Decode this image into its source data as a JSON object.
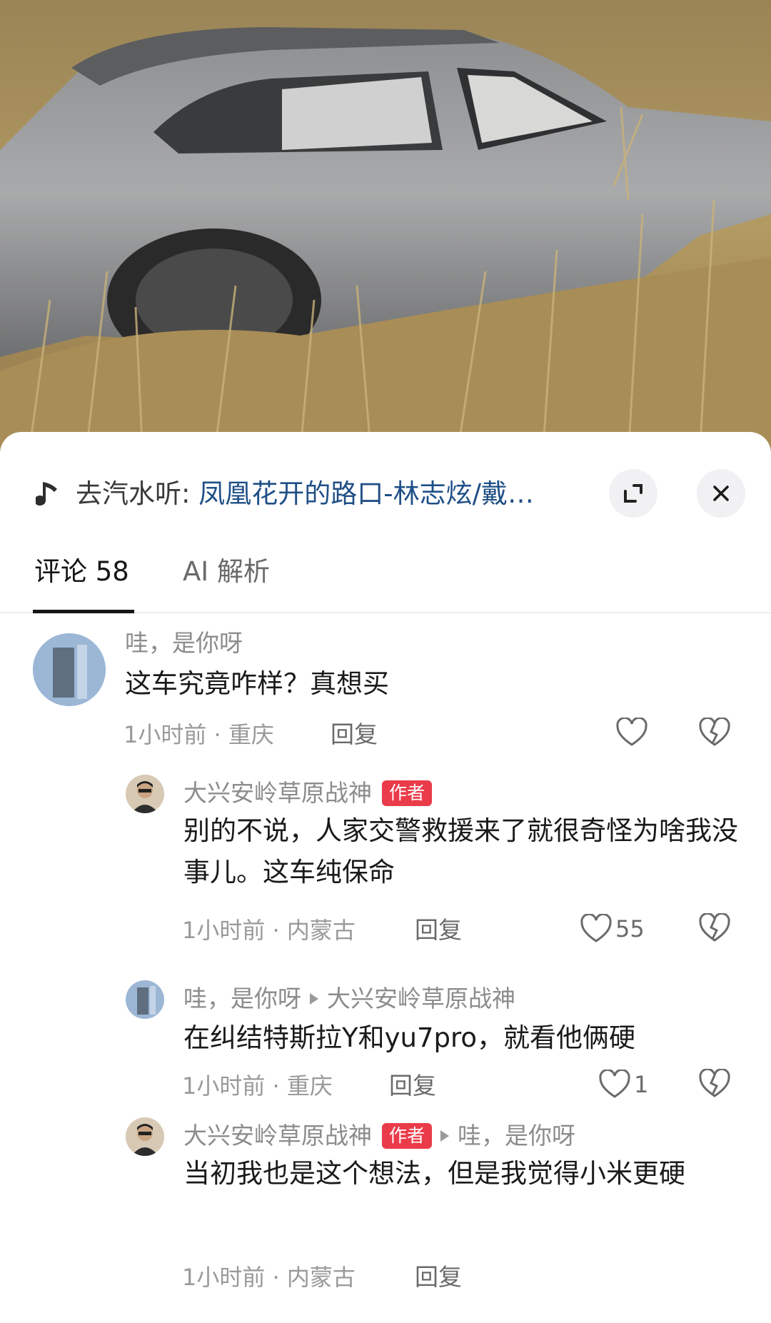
{
  "music": {
    "prefix": "去汽水听: ",
    "song": "凤凰花开的路口-林志炫/戴…"
  },
  "tabs": [
    {
      "label": "评论 58",
      "active": true
    },
    {
      "label": "AI 解析",
      "active": false
    }
  ],
  "comments": [
    {
      "user": "哇，是你呀",
      "text": "这车究竟咋样？真想买",
      "meta": "1小时前 · 重庆",
      "reply_label": "回复",
      "likes": ""
    },
    {
      "user": "大兴安岭草原战神",
      "badge": "作者",
      "text": "别的不说，人家交警救援来了就很奇怪为啥我没事儿。这车纯保命",
      "meta": "1小时前 · 内蒙古",
      "reply_label": "回复",
      "likes": "55"
    },
    {
      "user": "哇，是你呀",
      "reply_to": "大兴安岭草原战神",
      "text": "在纠结特斯拉Y和yu7pro，就看他俩硬",
      "meta": "1小时前 · 重庆",
      "reply_label": "回复",
      "likes": "1"
    },
    {
      "user": "大兴安岭草原战神",
      "badge": "作者",
      "reply_to": "哇，是你呀",
      "text": "当初我也是这个想法，但是我觉得小米更硬",
      "meta": "1小时前 · 内蒙古",
      "reply_label": "回复"
    }
  ],
  "colors": {
    "author_badge": "#ea3b4a",
    "song_link": "#1f4f86"
  }
}
